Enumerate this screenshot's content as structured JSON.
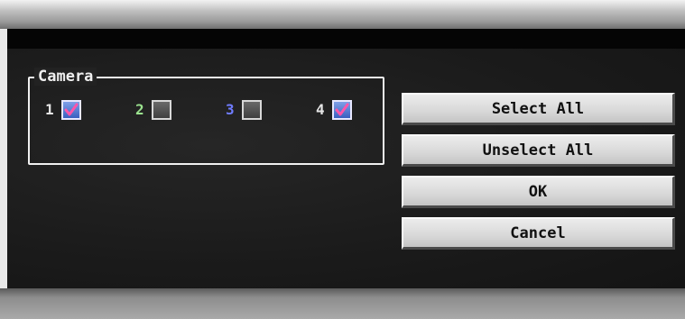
{
  "dialog": {
    "group_title": "Camera",
    "cameras": [
      {
        "label": "1",
        "selected": true,
        "label_color": "#e6e6e6"
      },
      {
        "label": "2",
        "selected": false,
        "label_color": "#9be38f"
      },
      {
        "label": "3",
        "selected": false,
        "label_color": "#6f7cff"
      },
      {
        "label": "4",
        "selected": true,
        "label_color": "#e6e6e6"
      }
    ],
    "buttons": {
      "select_all": "Select All",
      "unselect_all": "Unselect All",
      "ok": "OK",
      "cancel": "Cancel"
    }
  },
  "colors": {
    "panel_bg": "#1b1b1b",
    "button_face": "#d8d8d8",
    "checkbox_selected": "#5a7fd8",
    "check_mark": "#ff55aa"
  }
}
